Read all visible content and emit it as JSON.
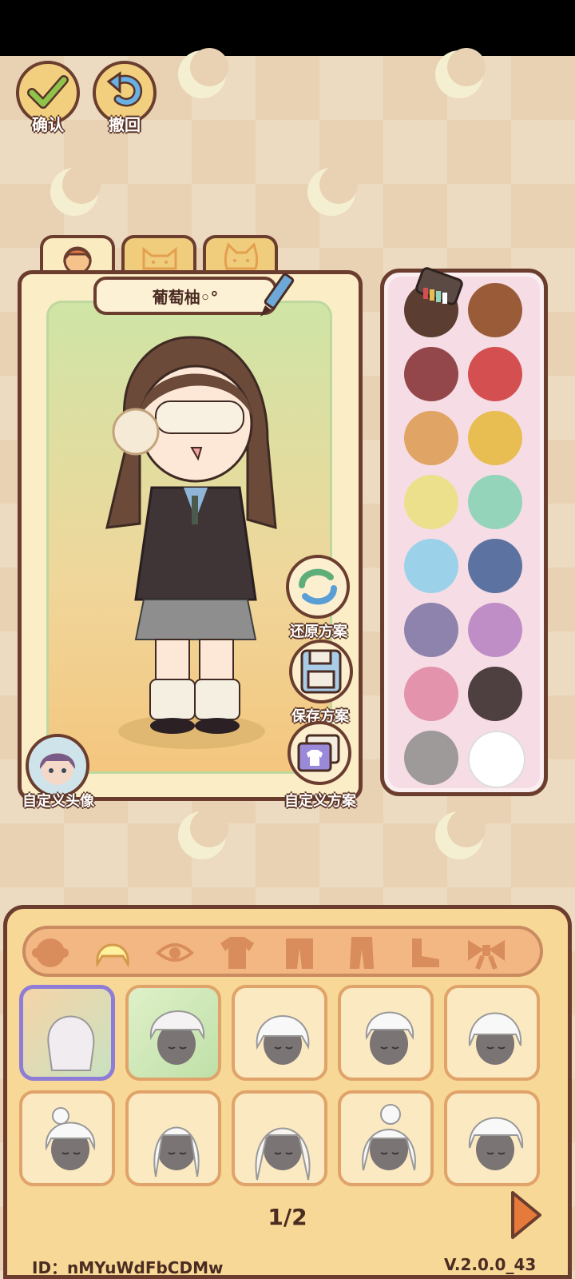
{
  "toolbar": {
    "confirm_label": "确认",
    "undo_label": "撤回"
  },
  "character": {
    "name": "葡萄柚◦°",
    "tabs": [
      "person-tab",
      "cat-tab",
      "cat-face-tab"
    ]
  },
  "side_buttons": {
    "restore_label": "还原方案",
    "save_label": "保存方案",
    "custom_avatar_label": "自定义头像",
    "custom_scheme_label": "自定义方案"
  },
  "palette": {
    "colors": [
      "#5b3e31",
      "#9a5b38",
      "#93474a",
      "#d45050",
      "#e0a464",
      "#e8bd52",
      "#ede08c",
      "#94d4ba",
      "#9bd2ea",
      "#5c73a2",
      "#8d83ad",
      "#c08ec6",
      "#e493ac",
      "#4e3f40",
      "#9e9a9a",
      "#ffffff"
    ]
  },
  "categories": [
    "face-icon",
    "hair-icon",
    "eye-icon",
    "shirt-icon",
    "coat-icon",
    "pants-icon",
    "shoes-icon",
    "bow-icon"
  ],
  "pager": {
    "text": "1/2"
  },
  "footer": {
    "id_text": "ID：nMYuWdFbCDMw",
    "version_text": "V.2.0.0_43"
  }
}
